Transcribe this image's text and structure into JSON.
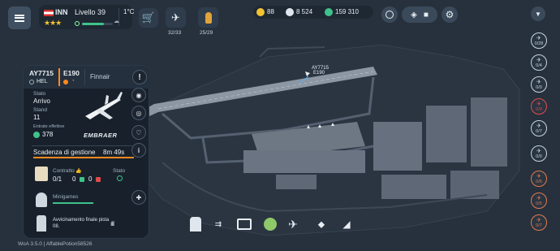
{
  "top_bar": {
    "country_code": "INN",
    "level_label": "Livello 39",
    "temperature": "1°C",
    "planes_count": "32/33",
    "staff_count": "25/29",
    "currency_star": "88",
    "currency_coins": "8 524",
    "currency_cash": "159 310"
  },
  "flight": {
    "code": "AY7715",
    "origin": "HEL",
    "aircraft_type": "E190",
    "airline": "Finnair",
    "state_label": "Stato",
    "state_value": "Arrivo",
    "stand_label": "Stand",
    "stand_value": "11",
    "revenue_label": "Entrate effettive",
    "revenue_value": "378",
    "manufacturer": "EMBRAER",
    "deadline_label": "Scadenza di gestione",
    "deadline_value": "8m 49s",
    "contract_label": "Contratto",
    "contract_value": "0/1",
    "contract_a": "0",
    "contract_b": "0",
    "status_label": "Stato",
    "minigames_label": "Minigames",
    "approach_label": "Avvicinamento finale pista",
    "approach_runway": "08."
  },
  "map": {
    "plane_label_code": "AY7715",
    "plane_label_type": "E190"
  },
  "side_queue": [
    {
      "value": "0/28",
      "color": "#c7d3df"
    },
    {
      "value": "0/4",
      "color": "#c7d3df"
    },
    {
      "value": "0/0",
      "color": "#c7d3df"
    },
    {
      "value": "0/0",
      "color": "#e04b4b"
    },
    {
      "value": "0/7",
      "color": "#c7d3df"
    },
    {
      "value": "0/0",
      "color": "#c7d3df"
    },
    {
      "value": "0/6",
      "color": "#e07a4b"
    },
    {
      "value": "0/5",
      "color": "#e07a4b"
    },
    {
      "value": "0/7",
      "color": "#e07a4b"
    }
  ],
  "footer": {
    "version": "WoA 3.5.0 | AffablePotion58526"
  },
  "colors": {
    "accent_green": "#3fc28a",
    "star_yellow": "#f2c230",
    "deadline_orange": "#ff8a1f",
    "alert_red": "#e04b4b"
  }
}
